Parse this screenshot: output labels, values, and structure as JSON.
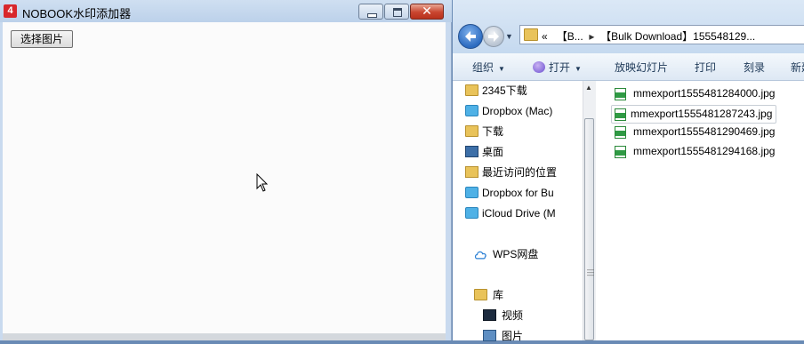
{
  "left_window": {
    "title": "NOBOOK水印添加器",
    "app_icon": "4",
    "controls": {
      "minimize": "minimize-icon",
      "maximize": "maximize-icon",
      "close": "close-icon"
    },
    "choose_button_label": "选择图片"
  },
  "explorer": {
    "address": {
      "prefix": "«",
      "crumb1": "【B...",
      "separator": "▸",
      "crumb2": "【Bulk Download】155548129..."
    },
    "toolbar": {
      "organize": "组织",
      "open": "打开",
      "slideshow": "放映幻灯片",
      "print": "打印",
      "burn": "刻录",
      "new": "新建"
    },
    "nav_items": [
      {
        "label": "2345下载",
        "icon": "folder-icon"
      },
      {
        "label": "Dropbox (Mac)",
        "icon": "dropbox-icon"
      },
      {
        "label": "下载",
        "icon": "folder-icon"
      },
      {
        "label": "桌面",
        "icon": "desktop-icon"
      },
      {
        "label": "最近访问的位置",
        "icon": "recent-places-icon"
      },
      {
        "label": "Dropbox for Bu",
        "icon": "dropbox-icon"
      },
      {
        "label": "iCloud Drive (M",
        "icon": "icloud-icon"
      },
      {
        "label": "WPS网盘",
        "icon": "cloud-icon"
      },
      {
        "label": "库",
        "icon": "library-icon"
      },
      {
        "label": "视频",
        "icon": "video-icon"
      },
      {
        "label": "图片",
        "icon": "pictures-icon"
      }
    ],
    "files": [
      {
        "name": "mmexport1555481284000.jpg",
        "selected": false
      },
      {
        "name": "mmexport1555481287243.jpg",
        "selected": true
      },
      {
        "name": "mmexport1555481290469.jpg",
        "selected": false
      },
      {
        "name": "mmexport1555481294168.jpg",
        "selected": false
      }
    ]
  }
}
